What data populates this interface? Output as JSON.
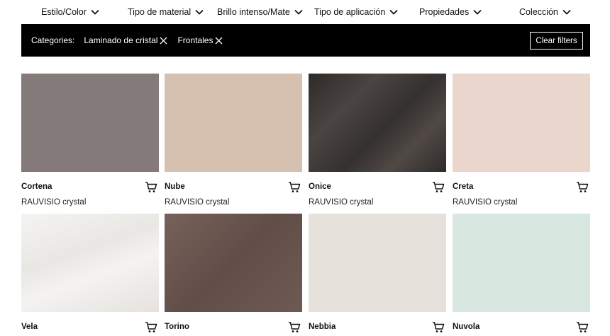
{
  "filters": [
    {
      "label": "Estilo/Color"
    },
    {
      "label": "Tipo de material"
    },
    {
      "label": "Brillo intenso/Mate"
    },
    {
      "label": "Tipo de aplicación"
    },
    {
      "label": "Propiedades"
    },
    {
      "label": "Colección"
    }
  ],
  "categories": {
    "label": "Categories:",
    "chips": [
      {
        "label": "Laminado de cristal"
      },
      {
        "label": "Frontales"
      }
    ],
    "clear_label": "Clear filters"
  },
  "products": [
    {
      "name": "Cortena",
      "collection": "RAUVISIO crystal",
      "color": "#857a7a"
    },
    {
      "name": "Nube",
      "collection": "RAUVISIO crystal",
      "color": "#d6c0b0"
    },
    {
      "name": "Onice",
      "collection": "RAUVISIO crystal",
      "color": "#3a3634"
    },
    {
      "name": "Creta",
      "collection": "RAUVISIO crystal",
      "color": "#ead6cc"
    },
    {
      "name": "Vela",
      "collection": "",
      "color": "#f2f0ee"
    },
    {
      "name": "Torino",
      "collection": "",
      "color": "#6b564f"
    },
    {
      "name": "Nebbia",
      "collection": "",
      "color": "#e6e1da"
    },
    {
      "name": "Nuvola",
      "collection": "",
      "color": "#d8e8e0"
    }
  ]
}
